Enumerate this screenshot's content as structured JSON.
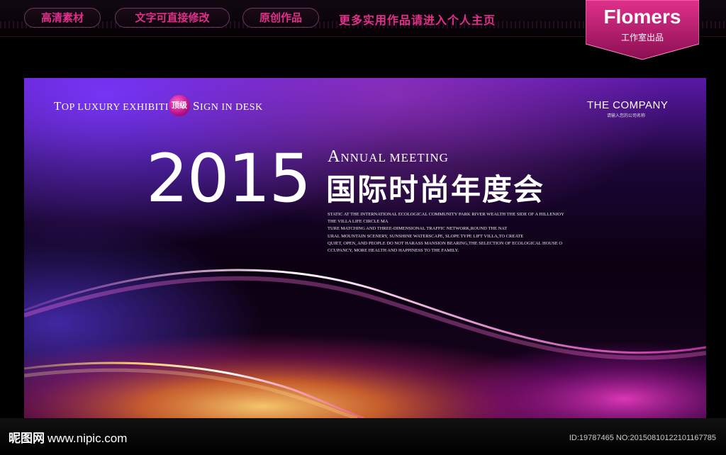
{
  "topbar": {
    "pills": [
      "高清素材",
      "文字可直接修改",
      "原创作品"
    ],
    "promo": "更多实用作品请进入个人主页",
    "badge_brand": "Flomers",
    "badge_sub": "工作室出品",
    "accent_color": "#e0308a"
  },
  "board": {
    "tagline_left": {
      "t1": "T",
      "t1_rest": "OP LUXURY EXHIBITION"
    },
    "tag_badge": "顶级",
    "tagline_right": {
      "s1": "S",
      "s1_rest": "IGN IN DESK"
    },
    "company": "THE COMPANY",
    "company_sub": "请输入您的公司名称",
    "year": "2015",
    "annual": {
      "a": "A",
      "a_rest": "NNUAL MEETING"
    },
    "title_cn": "国际时尚年度会",
    "description": [
      "STATIC AT THE INTERNATIONAL ECOLOGICAL COMMUNITY PARK RIVER WEALTH THE SIDE OF A HILLENJOY",
      "THE VILLA LIFE CIRCLE MA",
      "TURE MATCHING AND THREE-DIMENSIONAL TRAFFIC NETWORK,ROUND THE NAT",
      "URAL MOUNTAIN SCENERY, SUNSHINE WATERSCAPE, SLOPE TYPE LIFT VILLA,TO CREATE",
      "QUIET, OPEN, AND PEOPLE DO NOT HARASS MANSION BEARING,THE SELECTION OF ECOLOGICAL HOUSE O",
      "CCUPANCY, MORE HEALTH AND HAPPINESS TO THE FAMILY."
    ]
  },
  "footer": {
    "logo": "昵图网",
    "site": "www.nipic.com",
    "id_info": "ID:19787465 NO:20150810122101167785"
  }
}
